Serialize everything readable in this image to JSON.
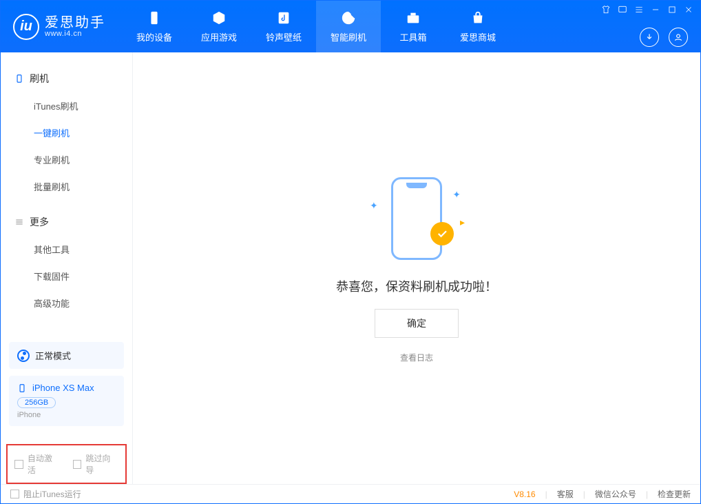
{
  "app": {
    "name": "爱思助手",
    "url": "www.i4.cn"
  },
  "tabs": {
    "device": "我的设备",
    "apps": "应用游戏",
    "ringtone": "铃声壁纸",
    "flash": "智能刷机",
    "toolbox": "工具箱",
    "store": "爱思商城"
  },
  "sidebar": {
    "flash_head": "刷机",
    "items": {
      "itunes": "iTunes刷机",
      "onekey": "一键刷机",
      "pro": "专业刷机",
      "batch": "批量刷机"
    },
    "more_head": "更多",
    "more": {
      "other": "其他工具",
      "firmware": "下载固件",
      "advanced": "高级功能"
    }
  },
  "mode": {
    "label": "正常模式"
  },
  "device": {
    "name": "iPhone XS Max",
    "capacity": "256GB",
    "type": "iPhone"
  },
  "checks": {
    "auto_activate": "自动激活",
    "skip_guide": "跳过向导"
  },
  "main": {
    "message": "恭喜您，保资料刷机成功啦！",
    "ok": "确定",
    "view_log": "查看日志"
  },
  "footer": {
    "block_itunes": "阻止iTunes运行",
    "version": "V8.16",
    "support": "客服",
    "wechat": "微信公众号",
    "update": "检查更新"
  }
}
